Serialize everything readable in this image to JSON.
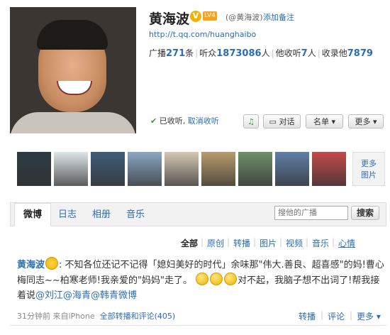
{
  "profile": {
    "name": "黄海波",
    "level": "LV4",
    "handle": "(@黄海波)",
    "add_remark": "添加备注",
    "url": "http://t.qq.com/huanghaibo",
    "stats": {
      "broadcast_label": "广播",
      "broadcast_value": "271",
      "broadcast_unit": "条",
      "listeners_label": "听众",
      "listeners_value": "1873086",
      "listeners_unit": "人",
      "following_label": "他收听",
      "following_value": "7",
      "following_unit": "人",
      "collected_label": "收录他",
      "collected_value": "7879"
    },
    "followed_text": "已收听",
    "unfollow": "取消收听",
    "buttons": {
      "chat": "对话",
      "list": "名单",
      "more": "更多"
    }
  },
  "photos": {
    "more_line1": "更多",
    "more_line2": "图片",
    "thumb_colors": [
      "#2c3a44",
      "#dfe6ea",
      "#3f5d7a",
      "#8aa7c4",
      "#d5c9b5",
      "#b89c6b",
      "#6f8f6a",
      "#5f7fa8",
      "#c24a4a"
    ]
  },
  "tabs": [
    "微博",
    "日志",
    "相册",
    "音乐"
  ],
  "search": {
    "placeholder": "搜他的广播",
    "button": "搜索"
  },
  "filters": [
    "全部",
    "原创",
    "转播",
    "图片",
    "视频",
    "音乐",
    "心情"
  ],
  "post": {
    "author": "黄海波",
    "text1": ": 不知各位还记不记得「媳妇美好的时代」余味那\"伟大.善良、超喜感\"的妈!曹心梅同志~~柏寒老师!我亲爱的\"妈妈\"走了。",
    "text2": "对不起，我脑子想不出词了!帮我接着说",
    "mention1": "@刘江",
    "mention2": "@海青",
    "mention3": "@韩青微博",
    "time": "31分钟前",
    "source": "来自iPhone",
    "comments": "全部转播和评论(405)",
    "actions": {
      "repost": "转播",
      "comment": "评论",
      "more": "更多"
    }
  }
}
